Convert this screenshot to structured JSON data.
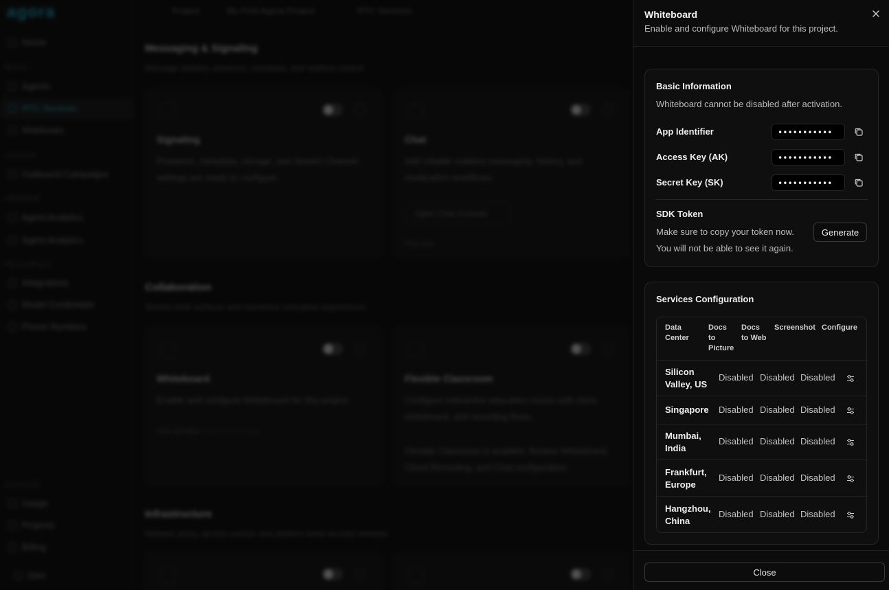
{
  "background": {
    "logo": "agora",
    "topbar": {
      "crumb1": "Project",
      "crumb2": "My First Agora Project",
      "crumb3": "RTC Services"
    },
    "sidebar": {
      "home": "Home",
      "sec_build": "BUILD",
      "agents": "Agents",
      "rtc_services": "RTC Services",
      "webhooks": "Webhooks",
      "sec_launch": "LAUNCH",
      "outbound": "Outbound Campaigns",
      "sec_observe": "OBSERVE",
      "agent_analytics_1": "Agent Analytics",
      "agent_analytics_2": "Agent Analytics",
      "sec_resources": "RESOURCES",
      "integrations": "Integrations",
      "model_credentials": "Model Credentials",
      "phone_numbers": "Phone Numbers",
      "sec_account": "ACCOUNT",
      "usage": "Usage",
      "projects": "Projects",
      "billing": "Billing",
      "user": "Sam"
    },
    "sections": [
      {
        "title": "Messaging & Signaling",
        "subtitle": "Message delivery, presence, metadata, and realtime control."
      },
      {
        "title": "Collaboration",
        "subtitle": "Shared work surfaces and interactive education experiences."
      },
      {
        "title": "Infrastructure",
        "subtitle": "Network proxy, access control, and platform-level security services."
      }
    ],
    "cards": {
      "signaling": {
        "title": "Signaling",
        "desc": "Presence, metadata, storage, and Stream Channel settings are ready to configure."
      },
      "chat": {
        "title": "Chat",
        "desc": "Add reliable realtime messaging, history, and moderation workflows.",
        "button": "Open Chat Console",
        "extra": "Pay-Use"
      },
      "whiteboard": {
        "title": "Whiteboard",
        "desc": "Enable and configure Whiteboard for this project.",
        "extra": "App Identifier • • • • • • • • • • • •"
      },
      "flexible": {
        "title": "Flexible Classroom",
        "desc": "Configure interactive education rooms with class, whiteboard, and recording flows.",
        "extra": "Flexible Classroom is enabled. Review Whiteboard, Cloud Recording, and Chat configuration."
      }
    }
  },
  "drawer": {
    "title": "Whiteboard",
    "subtitle": "Enable and configure Whiteboard for this project.",
    "basic": {
      "title": "Basic Information",
      "note": "Whiteboard cannot be disabled after activation.",
      "fields": [
        {
          "label": "App Identifier",
          "value": "•••••••••••"
        },
        {
          "label": "Access Key (AK)",
          "value": "•••••••••••"
        },
        {
          "label": "Secret Key (SK)",
          "value": "•••••••••••"
        }
      ],
      "sdk_title": "SDK Token",
      "sdk_note_1": "Make sure to copy your token now.",
      "sdk_note_2": "You will not be able to see it again.",
      "generate": "Generate"
    },
    "services": {
      "title": "Services Configuration",
      "headers": {
        "data_center": [
          "Data",
          "Center"
        ],
        "docs_to_picture": [
          "Docs",
          "to",
          "Picture"
        ],
        "docs_to_web": [
          "Docs",
          "to Web"
        ],
        "screenshot": "Screenshot",
        "configure": "Configure"
      },
      "rows": [
        {
          "dc": [
            "Silicon",
            "Valley, US"
          ],
          "docs_pic": "Disabled",
          "docs_web": "Disabled",
          "screenshot": "Disabled"
        },
        {
          "dc": [
            "Singapore"
          ],
          "docs_pic": "Disabled",
          "docs_web": "Disabled",
          "screenshot": "Disabled"
        },
        {
          "dc": [
            "Mumbai,",
            "India"
          ],
          "docs_pic": "Disabled",
          "docs_web": "Disabled",
          "screenshot": "Disabled"
        },
        {
          "dc": [
            "Frankfurt,",
            "Europe"
          ],
          "docs_pic": "Disabled",
          "docs_web": "Disabled",
          "screenshot": "Disabled"
        },
        {
          "dc": [
            "Hangzhou,",
            "China"
          ],
          "docs_pic": "Disabled",
          "docs_web": "Disabled",
          "screenshot": "Disabled"
        }
      ]
    },
    "close": "Close"
  },
  "icons": {
    "close": "close-icon",
    "copy": "copy-icon",
    "configure": "sliders-icon"
  }
}
